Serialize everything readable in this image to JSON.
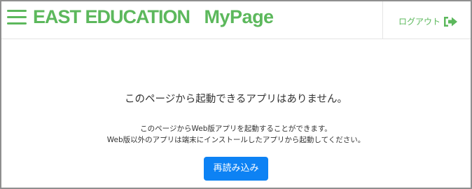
{
  "header": {
    "brand_name": "EAST EDUCATION",
    "brand_sub": "MyPage",
    "logout_label": "ログアウト",
    "menu_icon": "hamburger-menu-icon",
    "logout_icon": "sign-out-arrow-icon"
  },
  "main": {
    "title": "このページから起動できるアプリはありません。",
    "description_line1": "このページからWeb版アプリを起動することができます。",
    "description_line2": "Web版以外のアプリは端末にインストールしたアプリから起動してください。",
    "reload_button_label": "再読み込み"
  },
  "colors": {
    "brand_green": "#5cb85c",
    "button_blue": "#0d82f4",
    "text": "#333333"
  }
}
